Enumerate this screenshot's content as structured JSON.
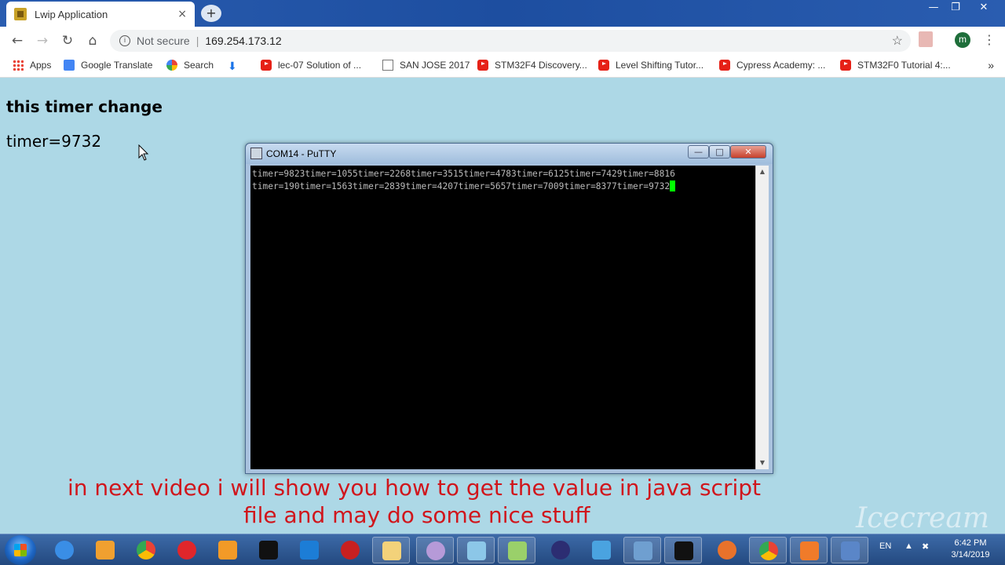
{
  "browser": {
    "tab_title": "Lwip Application",
    "tab_close": "×",
    "new_tab": "+",
    "security_text": "Not secure",
    "url": "169.254.173.12",
    "profile_initial": "m"
  },
  "bookmarks": [
    {
      "label": "Apps",
      "icon": "apps-grid-icon"
    },
    {
      "label": "Google Translate",
      "icon": "google-translate-icon"
    },
    {
      "label": "Search",
      "icon": "search-icon"
    },
    {
      "label": "",
      "icon": "download-icon"
    },
    {
      "label": "lec-07 Solution of ...",
      "icon": "youtube-icon"
    },
    {
      "label": "SAN JOSE 2017",
      "icon": "page-icon"
    },
    {
      "label": "STM32F4 Discovery...",
      "icon": "youtube-icon"
    },
    {
      "label": "Level Shifting Tutor...",
      "icon": "youtube-icon"
    },
    {
      "label": "Cypress Academy: ...",
      "icon": "youtube-icon"
    },
    {
      "label": "STM32F0 Tutorial 4:...",
      "icon": "youtube-icon"
    }
  ],
  "bookmarks_more": "»",
  "page": {
    "heading": "this timer change",
    "timer_text": "timer=9732"
  },
  "putty": {
    "title": "COM14 - PuTTY",
    "lines": [
      "timer=9823timer=1055timer=2268timer=3515timer=4783timer=6125timer=7429timer=8816",
      "timer=190timer=1563timer=2839timer=4207timer=5657timer=7009timer=8377timer=9732"
    ]
  },
  "caption": {
    "line1": "in next video i will show you how to get the value in java script",
    "line2": "file and may do some nice  stuff"
  },
  "watermark": "Icecream",
  "taskbar": {
    "language": "EN",
    "time": "6:42 PM",
    "date": "3/14/2019",
    "apps": [
      "internet-explorer-icon",
      "media-player-icon",
      "chrome-icon",
      "opera-icon",
      "sublime-icon",
      "m-app-icon",
      "app-s-icon",
      "red-tool-icon",
      "file-explorer-icon",
      "browser-icon",
      "photos-icon",
      "notepad-icon",
      "eclipse-icon",
      "box-icon",
      "screenshot-icon",
      "cmd-icon",
      "recorder-icon",
      "chrome-icon",
      "screen-recorder-icon",
      "network-icon"
    ]
  },
  "colors": {
    "page_bg": "#add8e6",
    "caption": "#d0161c",
    "terminal_bg": "#000000",
    "terminal_cursor": "#00ff00"
  }
}
